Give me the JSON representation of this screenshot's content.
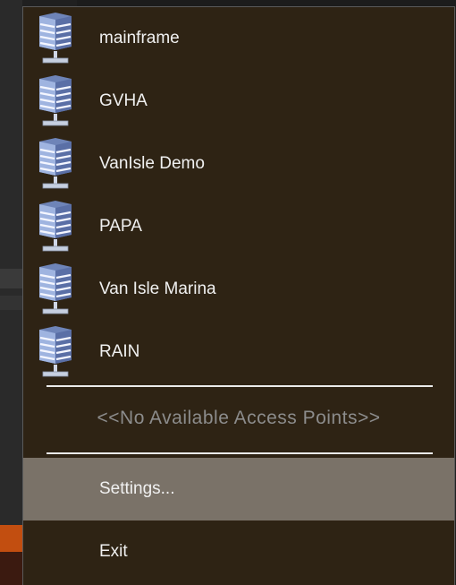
{
  "menu": {
    "networks": [
      {
        "label": "mainframe",
        "icon": "server-icon"
      },
      {
        "label": "GVHA",
        "icon": "server-icon"
      },
      {
        "label": "VanIsle Demo",
        "icon": "server-icon"
      },
      {
        "label": "PAPA",
        "icon": "server-icon"
      },
      {
        "label": "Van Isle Marina",
        "icon": "server-icon"
      },
      {
        "label": "RAIN",
        "icon": "server-icon"
      }
    ],
    "no_access_points": "<<No Available Access Points>>",
    "settings_label": "Settings...",
    "exit_label": "Exit"
  },
  "colors": {
    "menu_bg": "#2e2314",
    "highlight": "#7a7268",
    "text": "#f0f0f0",
    "disabled_text": "#8c8c8c"
  }
}
